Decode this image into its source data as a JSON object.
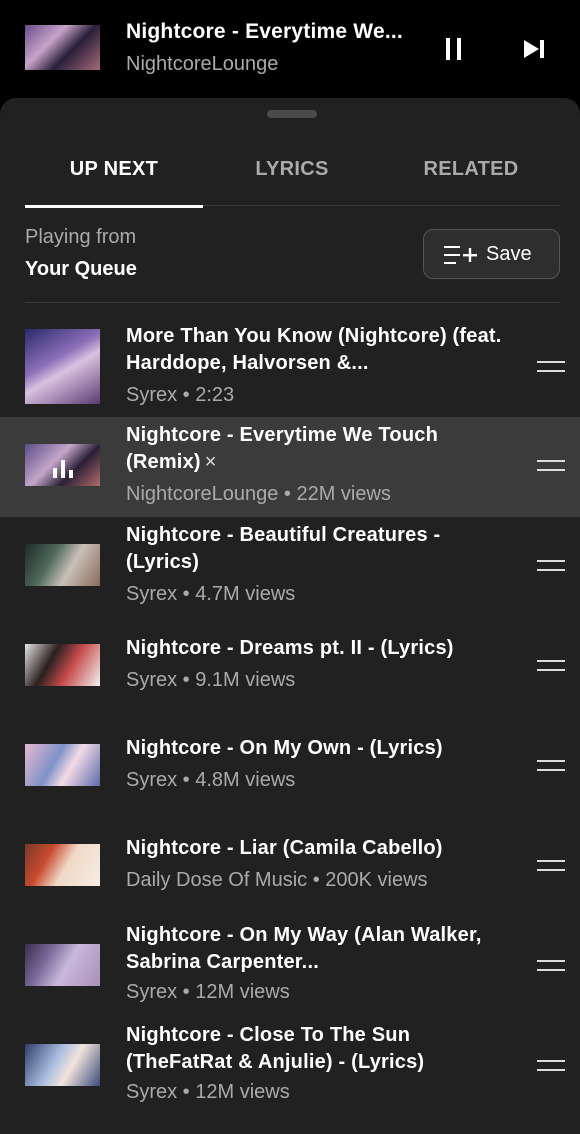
{
  "now_playing": {
    "title": "Nightcore  - Everytime We...",
    "artist": "NightcoreLounge",
    "controls": [
      "pause-icon",
      "skip-next-icon"
    ]
  },
  "tabs": [
    {
      "label": "UP NEXT",
      "active": true
    },
    {
      "label": "LYRICS",
      "active": false
    },
    {
      "label": "RELATED",
      "active": false
    }
  ],
  "queue_header": {
    "playing_from": "Playing from",
    "source": "Your Queue",
    "save_label": "Save",
    "save_icon": "playlist-add-icon"
  },
  "queue": [
    {
      "title": "More Than You Know (Nightcore) (feat. Harddope, Halvorsen &...",
      "subtitle": "Syrex • 2:23",
      "current": false,
      "thumb_colors": [
        "#2b2a6b",
        "#8c6fb8",
        "#d9c2e0",
        "#5b3a72"
      ]
    },
    {
      "title": "Nightcore  - Everytime We Touch (Remix)",
      "remove_icon": "×",
      "subtitle": "NightcoreLounge • 22M views",
      "current": true,
      "playing_icon": "equalizer-icon",
      "thumb_colors": [
        "#5b4c8a",
        "#c4a6c9",
        "#2a2036",
        "#b36b6b"
      ]
    },
    {
      "title": "Nightcore - Beautiful Creatures - (Lyrics)",
      "subtitle": "Syrex • 4.7M views",
      "current": false,
      "thumb_colors": [
        "#1f2a2a",
        "#4f6a5a",
        "#c9c0b8",
        "#8a6a5a"
      ]
    },
    {
      "title": "Nightcore - Dreams pt. II - (Lyrics)",
      "subtitle": "Syrex • 9.1M views",
      "current": false,
      "thumb_colors": [
        "#e8e6e6",
        "#2a2020",
        "#c74b4b",
        "#f2f2f2"
      ]
    },
    {
      "title": "Nightcore - On My Own - (Lyrics)",
      "subtitle": "Syrex • 4.8M views",
      "current": false,
      "thumb_colors": [
        "#e6b9d0",
        "#7f92c9",
        "#f4dbe6",
        "#5a6aa8"
      ]
    },
    {
      "title": "Nightcore - Liar (Camila Cabello)",
      "subtitle": "Daily Dose Of Music • 200K views",
      "current": false,
      "thumb_colors": [
        "#f5ede6",
        "#c74a2e",
        "#f0d9c6",
        "#7a3a2a"
      ]
    },
    {
      "title": "Nightcore - On My Way (Alan Walker, Sabrina Carpenter...",
      "subtitle": "Syrex • 12M views",
      "current": false,
      "thumb_colors": [
        "#7a6a9a",
        "#c9b8dc",
        "#3a2f4f",
        "#a88fb8"
      ]
    },
    {
      "title": "Nightcore - Close To The Sun (TheFatRat & Anjulie) - (Lyrics)",
      "subtitle": "Syrex • 12M views",
      "current": false,
      "thumb_colors": [
        "#2f3f6a",
        "#a9bde0",
        "#f2e4dc",
        "#3a4a7a"
      ]
    }
  ],
  "colors": {
    "background": "#000000",
    "sheet": "#212121",
    "current_row": "#3b3b3b",
    "secondary_text": "#aaaaaa"
  }
}
